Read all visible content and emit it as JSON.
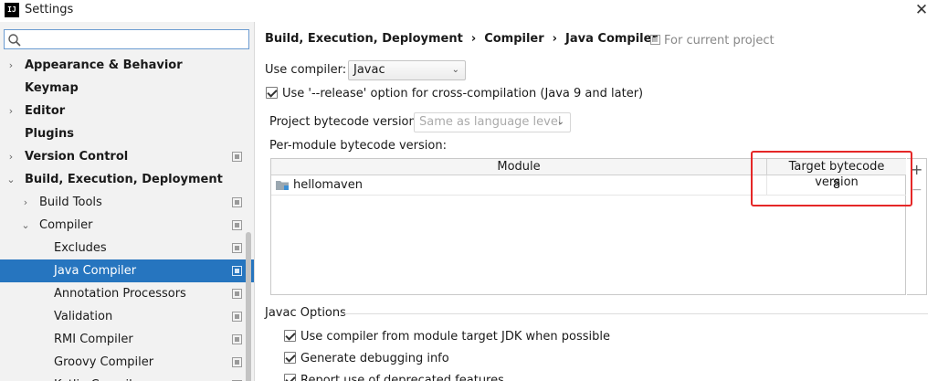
{
  "window": {
    "title": "Settings",
    "app_icon": "intellij-icon",
    "close_label": "✕"
  },
  "search": {
    "value": "",
    "placeholder": ""
  },
  "sidebar": {
    "items": [
      {
        "label": "Appearance & Behavior",
        "level": 0,
        "bold": true,
        "arrow": "›",
        "project": false,
        "selected": false
      },
      {
        "label": "Keymap",
        "level": 0,
        "bold": true,
        "arrow": "",
        "project": false,
        "selected": false
      },
      {
        "label": "Editor",
        "level": 0,
        "bold": true,
        "arrow": "›",
        "project": false,
        "selected": false
      },
      {
        "label": "Plugins",
        "level": 0,
        "bold": true,
        "arrow": "",
        "project": false,
        "selected": false
      },
      {
        "label": "Version Control",
        "level": 0,
        "bold": true,
        "arrow": "›",
        "project": true,
        "selected": false
      },
      {
        "label": "Build, Execution, Deployment",
        "level": 0,
        "bold": true,
        "arrow": "⌄",
        "project": false,
        "selected": false
      },
      {
        "label": "Build Tools",
        "level": 1,
        "bold": false,
        "arrow": "›",
        "project": true,
        "selected": false
      },
      {
        "label": "Compiler",
        "level": 1,
        "bold": false,
        "arrow": "⌄",
        "project": true,
        "selected": false
      },
      {
        "label": "Excludes",
        "level": 2,
        "bold": false,
        "arrow": "",
        "project": true,
        "selected": false
      },
      {
        "label": "Java Compiler",
        "level": 2,
        "bold": false,
        "arrow": "",
        "project": true,
        "selected": true
      },
      {
        "label": "Annotation Processors",
        "level": 2,
        "bold": false,
        "arrow": "",
        "project": true,
        "selected": false
      },
      {
        "label": "Validation",
        "level": 2,
        "bold": false,
        "arrow": "",
        "project": true,
        "selected": false
      },
      {
        "label": "RMI Compiler",
        "level": 2,
        "bold": false,
        "arrow": "",
        "project": true,
        "selected": false
      },
      {
        "label": "Groovy Compiler",
        "level": 2,
        "bold": false,
        "arrow": "",
        "project": true,
        "selected": false
      },
      {
        "label": "Kotlin Compiler",
        "level": 2,
        "bold": false,
        "arrow": "",
        "project": true,
        "selected": false
      }
    ]
  },
  "main": {
    "breadcrumb": [
      "Build, Execution, Deployment",
      "Compiler",
      "Java Compiler"
    ],
    "breadcrumb_sep": "›",
    "for_current_project": "For current project",
    "use_compiler_label": "Use compiler:",
    "use_compiler_value": "Javac",
    "release_option_label": "Use '--release' option for cross-compilation (Java 9 and later)",
    "release_option_checked": true,
    "project_bytecode_label": "Project bytecode version:",
    "project_bytecode_value": "Same as language level",
    "per_module_label": "Per-module bytecode version:",
    "table": {
      "columns": [
        "Module",
        "Target bytecode version"
      ],
      "rows": [
        {
          "module": "hellomaven",
          "target": "8"
        }
      ]
    },
    "javac_options_title": "Javac Options",
    "javac_options": [
      {
        "label": "Use compiler from module target JDK when possible",
        "checked": true
      },
      {
        "label": "Generate debugging info",
        "checked": true
      },
      {
        "label": "Report use of deprecated features",
        "checked": true
      }
    ],
    "highlight_color": "#e52727",
    "selection_color": "#2675bf"
  }
}
